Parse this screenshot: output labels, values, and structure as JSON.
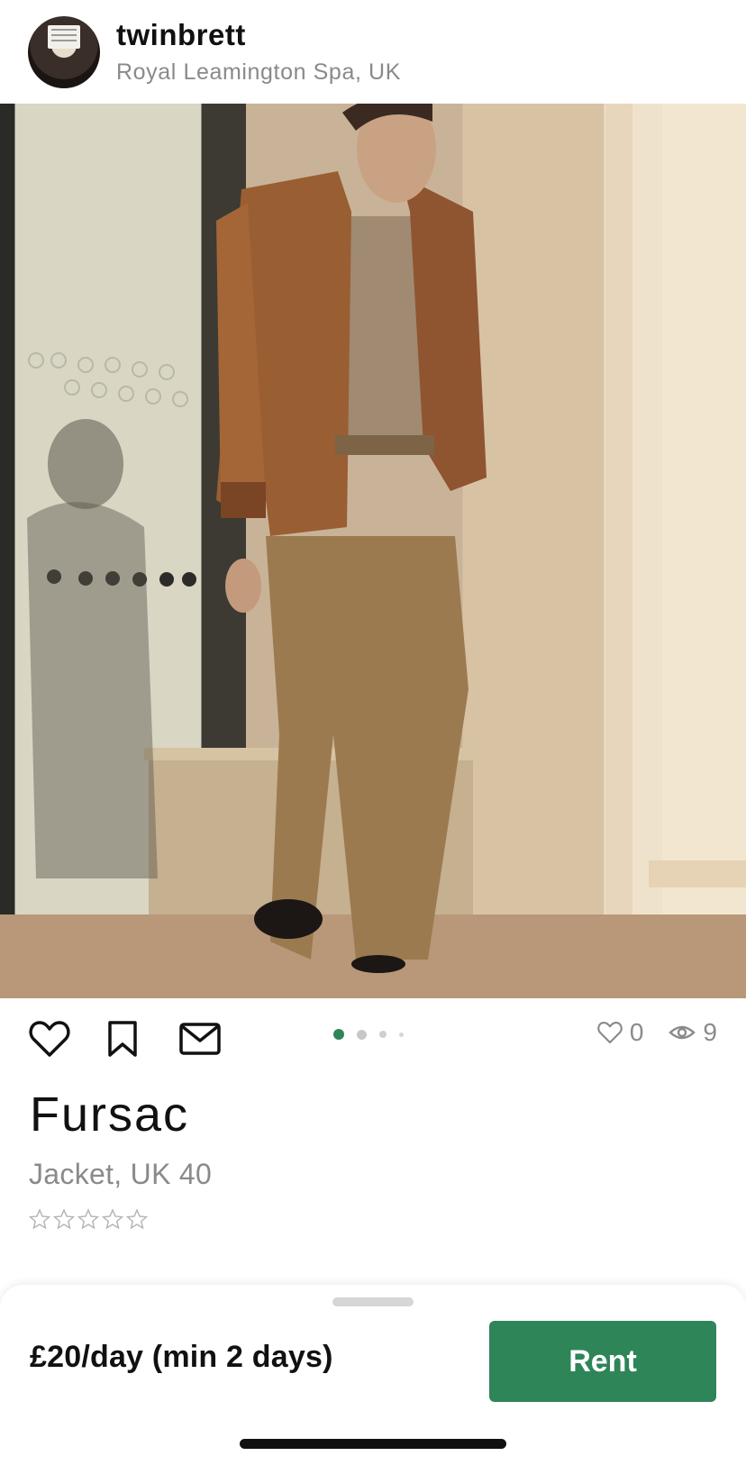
{
  "header": {
    "username": "twinbrett",
    "location": "Royal Leamington Spa, UK"
  },
  "photo": {
    "carousel_total": 4,
    "carousel_active_index": 0
  },
  "actions": {
    "like_icon": "heart-outline-icon",
    "save_icon": "bookmark-outline-icon",
    "message_icon": "envelope-icon"
  },
  "stats": {
    "likes": "0",
    "views": "9"
  },
  "item": {
    "brand": "Fursac",
    "subtitle": "Jacket, UK 40",
    "rating": 0,
    "rating_max": 5
  },
  "sheet": {
    "price": "£20/day (min 2 days)",
    "rent_label": "Rent"
  },
  "colors": {
    "accent": "#2e8558",
    "muted": "#8a8a8a",
    "text": "#111111"
  }
}
